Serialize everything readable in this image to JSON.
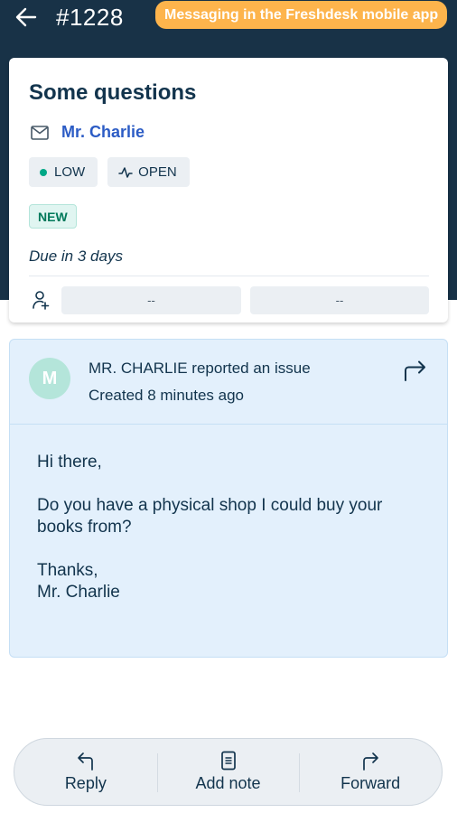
{
  "header": {
    "ticket_id": "#1228",
    "promo_badge": "Messaging in the Freshdesk mobile app",
    "back_icon": "arrow-left-icon"
  },
  "ticket": {
    "subject": "Some questions",
    "requester": "Mr. Charlie",
    "requester_icon": "mail-icon",
    "priority": {
      "label": "LOW",
      "color": "#00a886"
    },
    "status": {
      "label": "OPEN",
      "icon": "pulse-icon"
    },
    "tag": "NEW",
    "due": "Due in 3 days",
    "assign_icon": "add-user-icon",
    "group_value": "--",
    "agent_value": "--"
  },
  "conversation": {
    "avatar_initial": "M",
    "avatar_color": "#b4e5da",
    "reported": "MR. CHARLIE reported an issue",
    "created": "Created 8 minutes ago",
    "body": {
      "greeting": "Hi there,",
      "question": "Do you have a physical shop I could buy your books from?",
      "closing": "Thanks,",
      "signature": "Mr. Charlie"
    }
  },
  "actions": [
    {
      "label": "Reply",
      "icon": "reply-icon"
    },
    {
      "label": "Add note",
      "icon": "note-icon"
    },
    {
      "label": "Forward",
      "icon": "forward-icon"
    }
  ],
  "colors": {
    "header_bg": "#183247",
    "promo": "#fdb44c",
    "link": "#2c5cc5",
    "conversation_bg": "#e3f0fc"
  }
}
